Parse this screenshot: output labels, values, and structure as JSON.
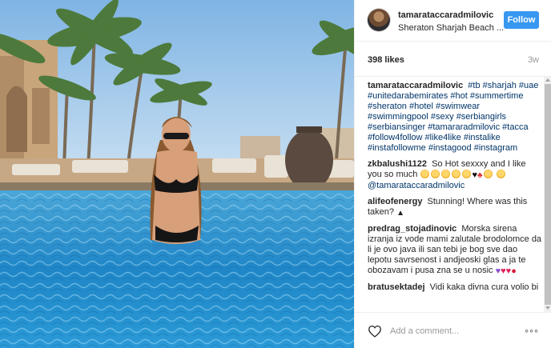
{
  "post": {
    "username": "tamarataccaradmilovic",
    "location": "Sheraton Sharjah Beach ...",
    "follow_label": "Follow",
    "likes": "398 likes",
    "age": "3w"
  },
  "caption": {
    "user": "tamarataccaradmilovic",
    "tags": [
      "#tb",
      "#sharjah",
      "#uae",
      "#unitedarabemirates",
      "#hot",
      "#summertime",
      "#sheraton",
      "#hotel",
      "#swimwear",
      "#swimmingpool",
      "#sexy",
      "#serbiangirls",
      "#serbiansinger",
      "#tamararadmilovic",
      "#tacca",
      "#follow4follow",
      "#like4like",
      "#instalike",
      "#instafollowme",
      "#instagood",
      "#instagram"
    ]
  },
  "comments": [
    {
      "user": "zkbalushi1122",
      "text": "So Hot sexxxy and I like you so much",
      "mention": "@tamarataccaradmilovic"
    },
    {
      "user": "alifeofenergy",
      "text": "Stunning! Where was this taken?"
    },
    {
      "user": "predrag_stojadinovic",
      "text": "Morska sirena izranja iz vode mami zalutale brodolomce da li je ovo java ili san tebi je bog sve dao lepotu savrsenost i andjeoski glas a ja te obozavam i pusa zna se u nosic"
    },
    {
      "user": "bratusektadej",
      "text": "Vidi kaka divna cura volio bi"
    }
  ],
  "footer": {
    "placeholder": "Add a comment...",
    "more": "◦◦◦"
  },
  "colors": {
    "accent": "#3897f0",
    "hashtag": "#003569",
    "muted": "#999999"
  },
  "icons": {
    "like": "heart-outline-icon",
    "more": "more-options-icon"
  }
}
